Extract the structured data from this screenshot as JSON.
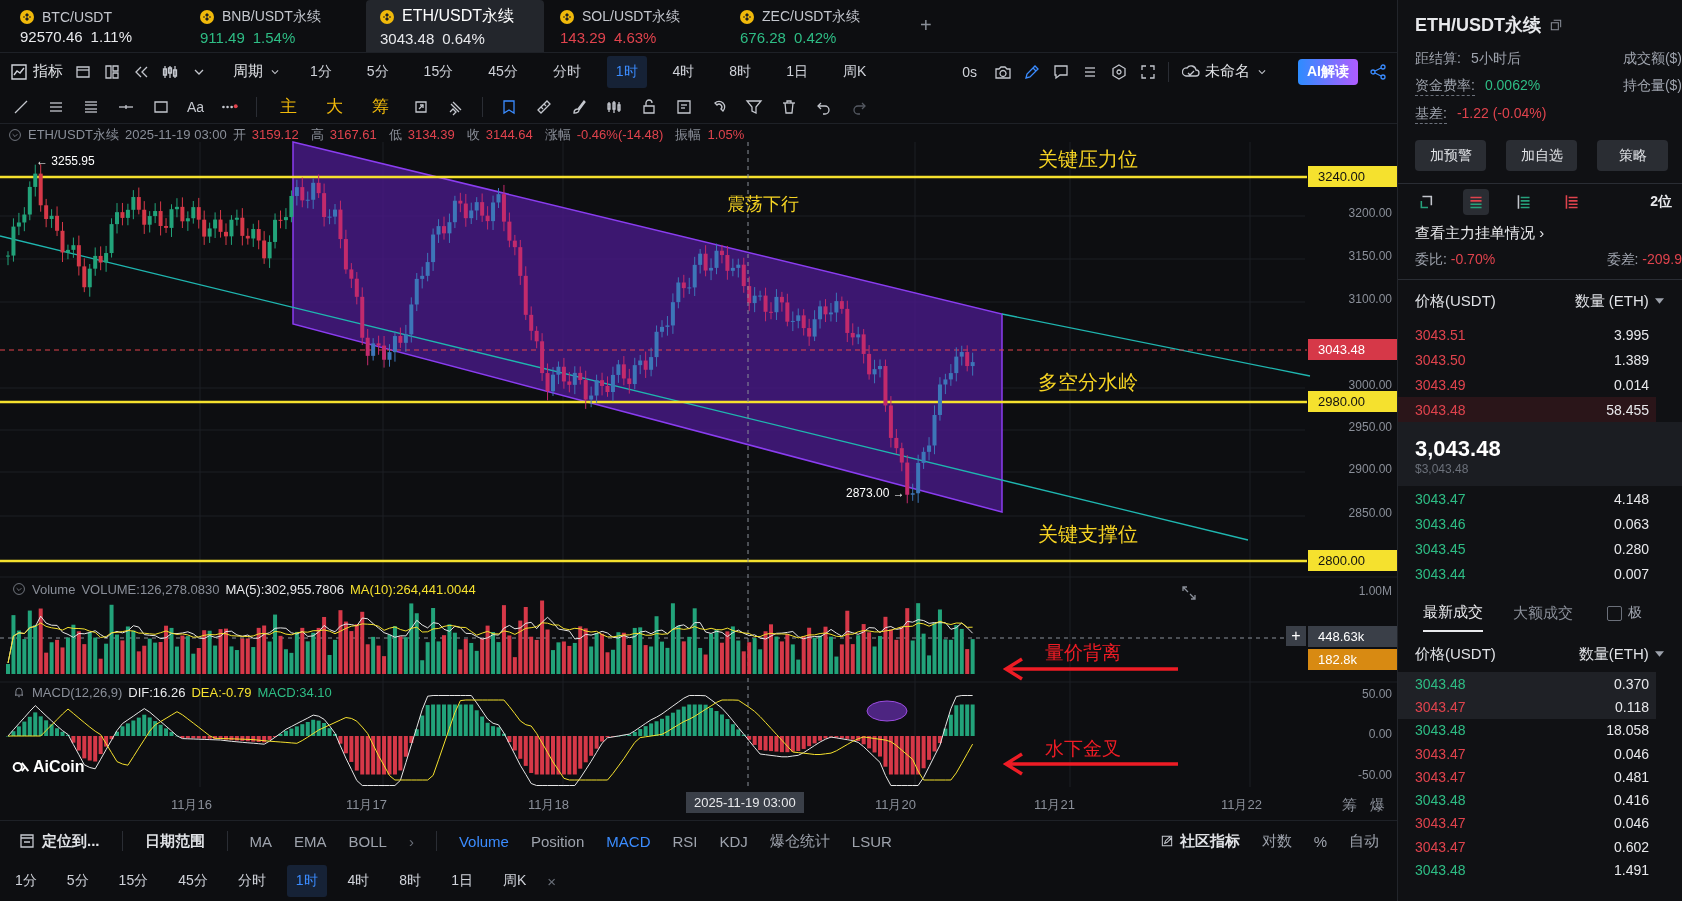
{
  "tickers": [
    {
      "pair": "BTC/USDT",
      "price": "92570.46",
      "change": "1.11%",
      "color": "#e8e9ec",
      "selected": false
    },
    {
      "pair": "BNB/USDT永续",
      "price": "911.49",
      "change": "1.54%",
      "color": "#2ebd85",
      "selected": false
    },
    {
      "pair": "ETH/USDT永续",
      "price": "3043.48",
      "change": "0.64%",
      "color": "#e8e9ec",
      "selected": true
    },
    {
      "pair": "SOL/USDT永续",
      "price": "143.29",
      "change": "4.63%",
      "color": "#e0434d",
      "selected": false
    },
    {
      "pair": "ZEC/USDT永续",
      "price": "676.28",
      "change": "0.42%",
      "color": "#2ebd85",
      "selected": false
    }
  ],
  "add_tab": "+",
  "toolbar": {
    "indicator_label": "指标",
    "period_label": "周期",
    "intervals": [
      {
        "label": "1分",
        "selected": false
      },
      {
        "label": "5分",
        "selected": false
      },
      {
        "label": "15分",
        "selected": false
      },
      {
        "label": "45分",
        "selected": false
      },
      {
        "label": "分时",
        "selected": false
      },
      {
        "label": "1时",
        "selected": true
      },
      {
        "label": "4时",
        "selected": false
      },
      {
        "label": "8时",
        "selected": false
      },
      {
        "label": "1日",
        "selected": false
      },
      {
        "label": "周K",
        "selected": false
      }
    ],
    "timer": "0s",
    "layout_name": "未命名",
    "ai_button": "AI解读"
  },
  "drawing_bar": {
    "text_tool": "Aa",
    "quick_tools": [
      "主",
      "大",
      "筹"
    ]
  },
  "chart_header": {
    "symbol": "ETH/USDT永续",
    "time": "2025-11-19 03:00",
    "fields": [
      {
        "label": "开",
        "value": "3159.12"
      },
      {
        "label": "高",
        "value": "3167.61"
      },
      {
        "label": "低",
        "value": "3134.39"
      },
      {
        "label": "收",
        "value": "3144.64"
      },
      {
        "label": "涨幅",
        "value": "-0.46%(-14.48)"
      },
      {
        "label": "振幅",
        "value": "1.05%"
      }
    ]
  },
  "main_chart": {
    "price_ticks": [
      "3200.00",
      "3150.00",
      "3100.00",
      "3000.00",
      "2950.00",
      "2900.00",
      "2850.00"
    ],
    "level_tags": [
      {
        "label": "3240.00",
        "kind": "level"
      },
      {
        "label": "3043.48",
        "kind": "current"
      },
      {
        "label": "2980.00",
        "kind": "level"
      },
      {
        "label": "2800.00",
        "kind": "level"
      }
    ],
    "annotations": [
      "关键压力位",
      "震荡下行",
      "多空分水岭",
      "关键支撑位"
    ],
    "high_marker": "← 3255.95",
    "low_marker": "2873.00 →"
  },
  "volume_pane": {
    "title": "Volume",
    "value": "VOLUME:126,278.0830",
    "ma5": "MA(5):302,955.7806",
    "ma10": "MA(10):264,441.0044",
    "axis_label": "1.00M",
    "crosshair_tag": "448.63k",
    "last_tag": "182.8k",
    "plus": "+",
    "annotation": "量价背离"
  },
  "macd_pane": {
    "title": "MACD(12,26,9)",
    "dif": "DIF:16.26",
    "dea": "DEA:-0.79",
    "macd": "MACD:34.10",
    "ticks": [
      "50.00",
      "0.00",
      "-50.00"
    ],
    "annotation": "水下金叉"
  },
  "logo": "AiCoin",
  "x_axis": {
    "labels": [
      "11月16",
      "11月17",
      "11月18",
      "11月20",
      "11月21",
      "11月22"
    ],
    "crosshair_label": "2025-11-19 03:00",
    "extras": [
      "筹",
      "爆"
    ]
  },
  "bottom_bar": {
    "locate": "定位到...",
    "date_range": "日期范围",
    "more": "›",
    "indicators": [
      {
        "label": "MA",
        "selected": false
      },
      {
        "label": "EMA",
        "selected": false
      },
      {
        "label": "BOLL",
        "selected": false
      }
    ],
    "sub_indicators": [
      {
        "label": "Volume",
        "selected": true
      },
      {
        "label": "Position",
        "selected": false
      },
      {
        "label": "MACD",
        "selected": true
      },
      {
        "label": "RSI",
        "selected": false
      },
      {
        "label": "KDJ",
        "selected": false
      },
      {
        "label": "爆仓统计",
        "selected": false
      },
      {
        "label": "LSUR",
        "selected": false
      }
    ],
    "community": "社区指标",
    "options": [
      "对数",
      "%",
      "自动"
    ]
  },
  "interval_bar": {
    "intervals": [
      {
        "label": "1分",
        "selected": false
      },
      {
        "label": "5分",
        "selected": false
      },
      {
        "label": "15分",
        "selected": false
      },
      {
        "label": "45分",
        "selected": false
      },
      {
        "label": "分时",
        "selected": false
      },
      {
        "label": "1时",
        "selected": true
      },
      {
        "label": "4时",
        "selected": false
      },
      {
        "label": "8时",
        "selected": false
      },
      {
        "label": "1日",
        "selected": false
      },
      {
        "label": "周K",
        "selected": false
      }
    ],
    "close": "×"
  },
  "side_panel": {
    "title": "ETH/USDT永续",
    "stats": [
      {
        "label": "距结算:",
        "value": "5小时后",
        "color": "#9ea3ad"
      },
      {
        "label": "资金费率:",
        "value": "0.0062%",
        "color": "#2ebd85"
      },
      {
        "label": "基差:",
        "value": "-1.22 (-0.04%)",
        "color": "#e0434d"
      }
    ],
    "stats_right": [
      "成交额($)",
      "持仓量($)"
    ],
    "buttons": [
      "加预警",
      "加自选",
      "策略"
    ],
    "depth_label": "2位",
    "view_link": "查看主力挂单情况 ›",
    "ratio": {
      "label": "委比:",
      "value": "-0.70%"
    },
    "diff": {
      "label": "委差:",
      "value": "-209.9"
    },
    "book_columns": [
      "价格(USDT)",
      "数量 (ETH)"
    ],
    "asks": [
      {
        "price": "3043.51",
        "qty": "3.995",
        "highlighted": false
      },
      {
        "price": "3043.50",
        "qty": "1.389",
        "highlighted": false
      },
      {
        "price": "3043.49",
        "qty": "0.014",
        "highlighted": false
      },
      {
        "price": "3043.48",
        "qty": "58.455",
        "highlighted": true
      }
    ],
    "last_price": "3,043.48",
    "last_price_usd": "$3,043.48",
    "bids": [
      {
        "price": "3043.47",
        "qty": "4.148"
      },
      {
        "price": "3043.46",
        "qty": "0.063"
      },
      {
        "price": "3043.45",
        "qty": "0.280"
      },
      {
        "price": "3043.44",
        "qty": "0.007"
      }
    ],
    "trade_tabs": [
      {
        "label": "最新成交",
        "selected": true
      },
      {
        "label": "大额成交",
        "selected": false
      }
    ],
    "checkbox": {
      "label": "极",
      "checked": false
    },
    "trade_columns": [
      "价格(USDT)",
      "数量(ETH)"
    ],
    "trades": [
      {
        "price": "3043.48",
        "qty": "0.370",
        "color": "#2ebd85",
        "highlighted": true
      },
      {
        "price": "3043.47",
        "qty": "0.118",
        "color": "#e0434d",
        "highlighted": true
      },
      {
        "price": "3043.48",
        "qty": "18.058",
        "color": "#2ebd85",
        "highlighted": false
      },
      {
        "price": "3043.47",
        "qty": "0.046",
        "color": "#e0434d",
        "highlighted": false
      },
      {
        "price": "3043.47",
        "qty": "0.481",
        "color": "#e0434d",
        "highlighted": false
      },
      {
        "price": "3043.48",
        "qty": "0.416",
        "color": "#2ebd85",
        "highlighted": false
      },
      {
        "price": "3043.47",
        "qty": "0.046",
        "color": "#e0434d",
        "highlighted": false
      },
      {
        "price": "3043.47",
        "qty": "0.602",
        "color": "#e0434d",
        "highlighted": false
      },
      {
        "price": "3043.48",
        "qty": "1.491",
        "color": "#2ebd85",
        "highlighted": false
      }
    ]
  }
}
